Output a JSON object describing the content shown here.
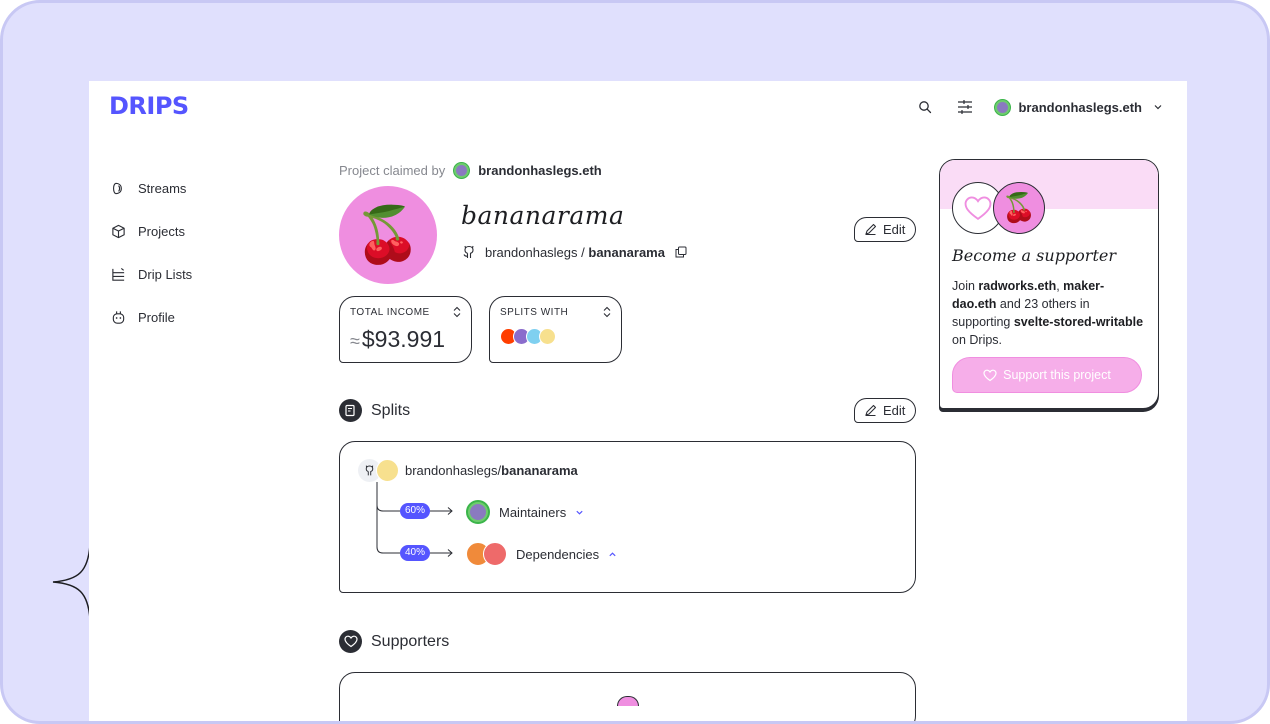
{
  "app": {
    "logo": "DRIPS",
    "user_name": "brandonhaslegs.eth"
  },
  "sidebar": {
    "items": [
      {
        "label": "Streams",
        "icon": "streams-icon"
      },
      {
        "label": "Projects",
        "icon": "projects-icon"
      },
      {
        "label": "Drip Lists",
        "icon": "drip-lists-icon"
      },
      {
        "label": "Profile",
        "icon": "profile-icon"
      }
    ]
  },
  "project": {
    "claimed_label": "Project claimed by",
    "claimed_by": "brandonhaslegs.eth",
    "name": "bananarama",
    "repo_owner": "brandonhaslegs",
    "repo_sep": " / ",
    "repo_name": "bananarama",
    "edit_label": "Edit",
    "avatar_emoji": "🍒"
  },
  "stats": {
    "total_income": {
      "label": "TOTAL INCOME",
      "approx": "≈",
      "value": "$93.991"
    },
    "splits_with": {
      "label": "SPLITS WITH"
    }
  },
  "splits": {
    "title": "Splits",
    "edit_label": "Edit",
    "repo_owner": "brandonhaslegs",
    "repo_sep": "/",
    "repo_name": "bananarama",
    "rows": [
      {
        "percent": "60%",
        "label": "Maintainers",
        "expanded": false
      },
      {
        "percent": "40%",
        "label": "Dependencies",
        "expanded": true
      }
    ]
  },
  "supporters": {
    "title": "Supporters"
  },
  "support_card": {
    "title": "Become a supporter",
    "text_prefix": "Join ",
    "name1": "radworks.eth",
    "sep1": ", ",
    "name2": "maker-dao.eth",
    "mid": " and 23 others in supporting ",
    "name3": "svelte-stored-writable",
    "suffix": " on Drips.",
    "button": "Support this project"
  },
  "colors": {
    "brand": "#5555ff",
    "page_bg": "#e0e0fd",
    "pink": "#ef8ee0",
    "text": "#2b2d34"
  }
}
